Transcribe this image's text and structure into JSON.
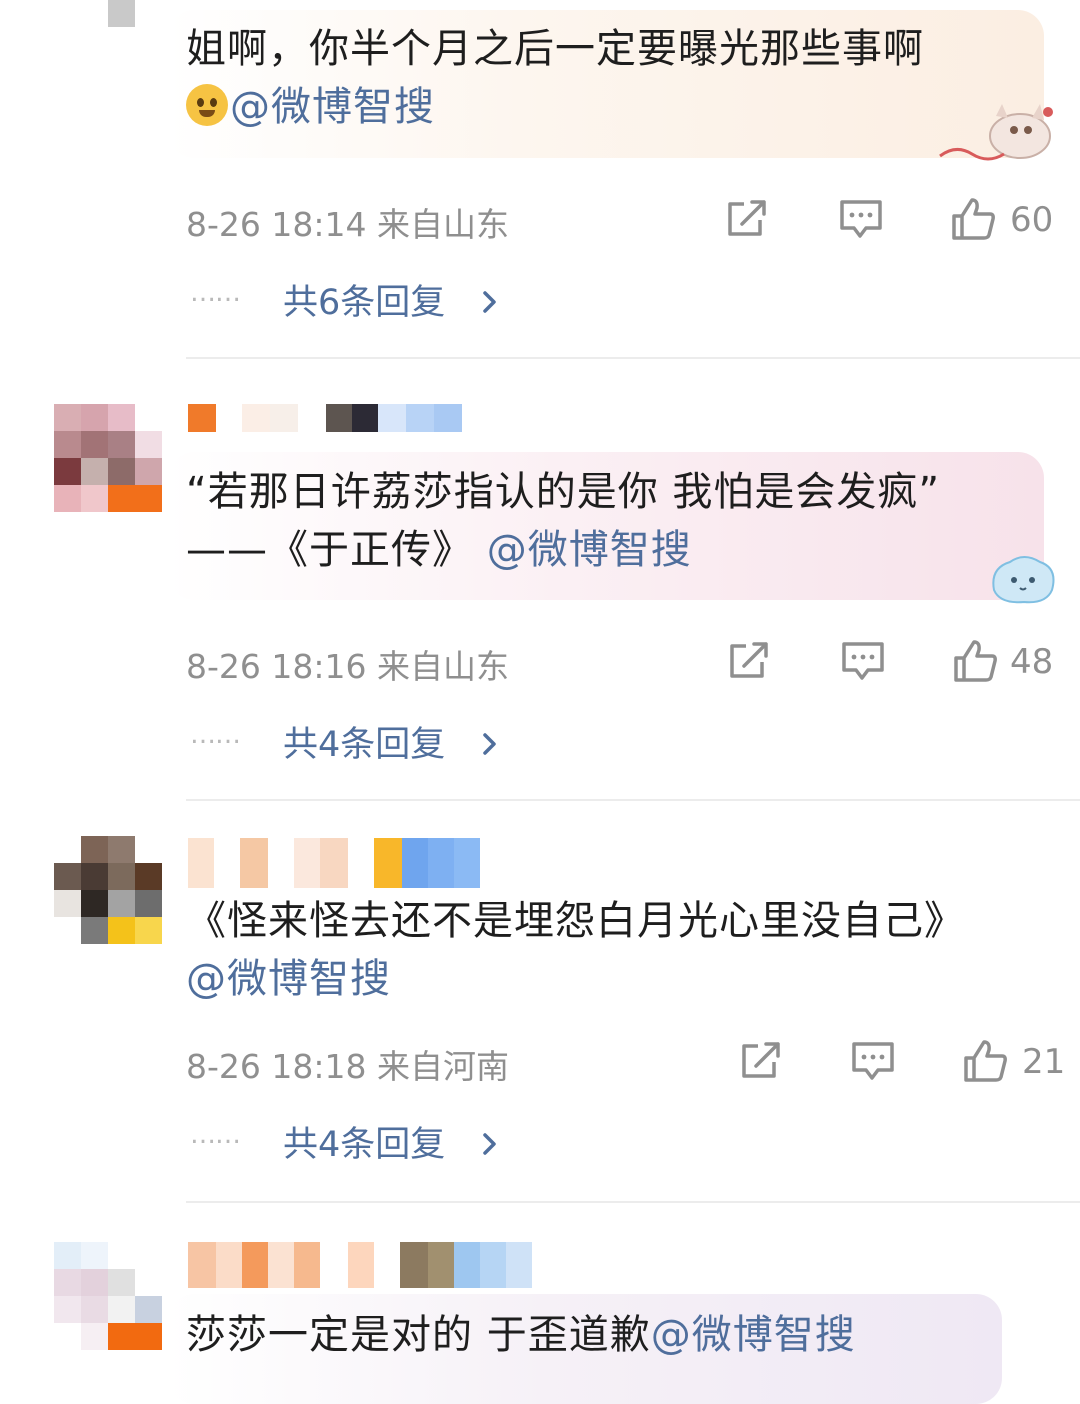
{
  "comments": [
    {
      "text": "姐啊，你半个月之后一定要曝光那些事啊",
      "emoji": "crying-face",
      "mention": "@微博智搜",
      "date": "8-26 18:14",
      "location": "来自山东",
      "likes": "60",
      "replies_dots": "……",
      "replies_label": "共6条回复"
    },
    {
      "quote": "“若那日许荔莎指认的是你 我怕是会发疯”",
      "source": "——《于正传》",
      "mention": "@微博智搜",
      "date": "8-26 18:16",
      "location": "来自山东",
      "likes": "48",
      "replies_dots": "……",
      "replies_label": "共4条回复"
    },
    {
      "text": "《怪来怪去还不是埋怨白月光心里没自己》",
      "mention": "@微博智搜",
      "date": "8-26 18:18",
      "location": "来自河南",
      "likes": "21",
      "replies_dots": "……",
      "replies_label": "共4条回复"
    },
    {
      "text": "莎莎一定是对的 于歪道歉",
      "mention": "@微博智搜"
    }
  ],
  "colors": {
    "mention": "#4f6e9c",
    "meta": "#8f8f8f",
    "divider": "#ececec"
  }
}
